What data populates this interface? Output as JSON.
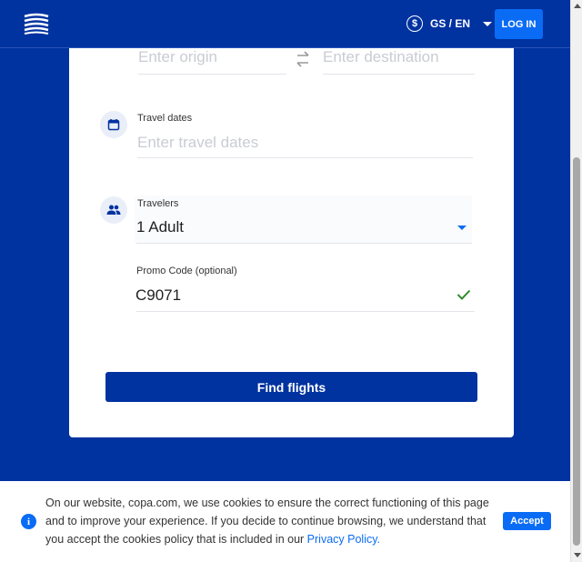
{
  "header": {
    "currency_symbol": "$",
    "locale_label": "GS / EN",
    "login_label": "LOG IN"
  },
  "search": {
    "origin_placeholder": "Enter origin",
    "destination_placeholder": "Enter destination",
    "dates_label": "Travel dates",
    "dates_placeholder": "Enter travel dates",
    "travelers_label": "Travelers",
    "travelers_value": "1 Adult",
    "promo_label": "Promo Code (optional)",
    "promo_value": "C9071",
    "find_button_label": "Find flights"
  },
  "cookie": {
    "info_glyph": "i",
    "text": "On our website, copa.com, we use cookies to ensure the correct functioning of this page and to improve your experience. If you decide to continue browsing, we understand that you accept the cookies policy that is included in our ",
    "link_label": "Privacy Policy.",
    "accept_label": "Accept"
  },
  "colors": {
    "brand_blue": "#0032a0",
    "accent_blue": "#0a6cf5",
    "success_green": "#2e8b2e"
  }
}
